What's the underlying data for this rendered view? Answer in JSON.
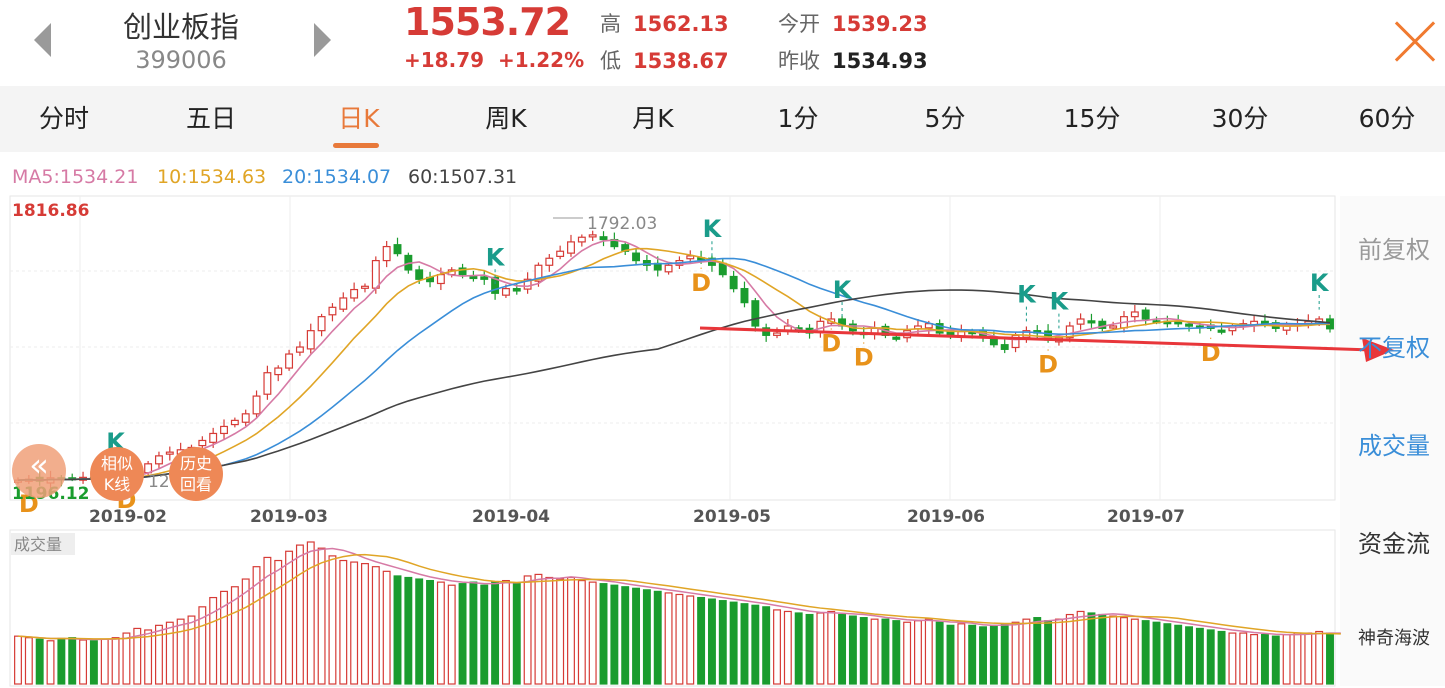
{
  "header": {
    "name": "创业板指",
    "code": "399006",
    "price": "1553.72",
    "change": "+18.79",
    "change_pct": "+1.22%",
    "high_label": "高",
    "high": "1562.13",
    "low_label": "低",
    "low": "1538.67",
    "open_label": "今开",
    "open": "1539.23",
    "prev_label": "昨收",
    "prev": "1534.93"
  },
  "tabs": [
    "分时",
    "五日",
    "日K",
    "周K",
    "月K",
    "1分",
    "5分",
    "15分",
    "30分",
    "60分"
  ],
  "active_tab": 2,
  "ma_labels": {
    "ma5": "MA5:1534.21",
    "ma10": "10:1534.63",
    "ma20": "20:1534.07",
    "ma60": "60:1507.31"
  },
  "side_menu": {
    "qfq": "前复权",
    "bfq": "不复权",
    "volume": "成交量",
    "capital": "资金流",
    "magic": "神奇海波"
  },
  "badges": {
    "similar": "相似\nK线",
    "history": "历史\n回看",
    "back": "«"
  },
  "colors": {
    "up": "#d63b36",
    "down": "#1a9c2e",
    "ma5": "#d67aa5",
    "ma10": "#e0a526",
    "ma20": "#3a8ed8",
    "ma60": "#444444",
    "accent": "#e8793a",
    "trend": "#e8363a",
    "signal_k": "#1a9c8a",
    "signal_d": "#e8921a"
  },
  "chart_data": {
    "type": "candlestick",
    "title": "创业板指",
    "y_max_label": "1816.86",
    "y_min_label": "1196.12",
    "high_annotation": "1792.03",
    "low_annotation": "12",
    "ylim": [
      1196.12,
      1816.86
    ],
    "x_ticks": [
      "2019-02",
      "2019-03",
      "2019-04",
      "2019-05",
      "2019-06",
      "2019-07"
    ],
    "volume_label": "成交量",
    "signals": [
      {
        "t": "D",
        "i": 1
      },
      {
        "t": "D",
        "i": 10
      },
      {
        "t": "K",
        "i": 9
      },
      {
        "t": "K",
        "i": 44
      },
      {
        "t": "K",
        "i": 64
      },
      {
        "t": "D",
        "i": 63
      },
      {
        "t": "K",
        "i": 76
      },
      {
        "t": "D",
        "i": 75
      },
      {
        "t": "D",
        "i": 78
      },
      {
        "t": "K",
        "i": 93
      },
      {
        "t": "K",
        "i": 96
      },
      {
        "t": "D",
        "i": 95
      },
      {
        "t": "D",
        "i": 110
      },
      {
        "t": "K",
        "i": 120
      }
    ],
    "closes": [
      1230,
      1232,
      1228,
      1235,
      1231,
      1234,
      1236,
      1233,
      1237,
      1235,
      1240,
      1250,
      1265,
      1282,
      1290,
      1295,
      1300,
      1315,
      1330,
      1345,
      1358,
      1372,
      1410,
      1460,
      1470,
      1500,
      1515,
      1550,
      1580,
      1600,
      1620,
      1638,
      1645,
      1700,
      1730,
      1715,
      1680,
      1660,
      1655,
      1670,
      1680,
      1670,
      1665,
      1660,
      1630,
      1640,
      1635,
      1660,
      1690,
      1705,
      1720,
      1740,
      1750,
      1755,
      1745,
      1730,
      1720,
      1700,
      1690,
      1680,
      1690,
      1700,
      1710,
      1705,
      1690,
      1670,
      1640,
      1610,
      1560,
      1540,
      1545,
      1560,
      1555,
      1545,
      1570,
      1575,
      1560,
      1550,
      1545,
      1555,
      1540,
      1535,
      1550,
      1560,
      1565,
      1545,
      1540,
      1548,
      1545,
      1540,
      1520,
      1510,
      1540,
      1550,
      1545,
      1530,
      1535,
      1560,
      1575,
      1570,
      1555,
      1560,
      1580,
      1590,
      1575,
      1570,
      1565,
      1568,
      1560,
      1558,
      1555,
      1550,
      1560,
      1565,
      1570,
      1563,
      1555,
      1560,
      1565,
      1570,
      1575,
      1554
    ],
    "volumes": [
      310,
      300,
      290,
      280,
      295,
      300,
      285,
      280,
      290,
      300,
      330,
      360,
      350,
      380,
      400,
      420,
      440,
      500,
      560,
      600,
      630,
      680,
      760,
      820,
      800,
      860,
      900,
      920,
      880,
      830,
      800,
      790,
      780,
      760,
      730,
      700,
      690,
      680,
      670,
      660,
      640,
      650,
      660,
      640,
      660,
      670,
      650,
      700,
      710,
      690,
      680,
      690,
      670,
      660,
      650,
      640,
      630,
      620,
      610,
      600,
      590,
      580,
      570,
      560,
      550,
      540,
      530,
      520,
      510,
      500,
      480,
      470,
      460,
      450,
      460,
      470,
      450,
      440,
      430,
      420,
      420,
      410,
      400,
      410,
      420,
      400,
      380,
      390,
      380,
      370,
      380,
      390,
      400,
      420,
      430,
      410,
      420,
      450,
      470,
      460,
      450,
      440,
      430,
      420,
      410,
      400,
      390,
      380,
      370,
      360,
      350,
      340,
      330,
      330,
      320,
      320,
      310,
      320,
      330,
      330,
      340,
      330,
      320
    ]
  }
}
